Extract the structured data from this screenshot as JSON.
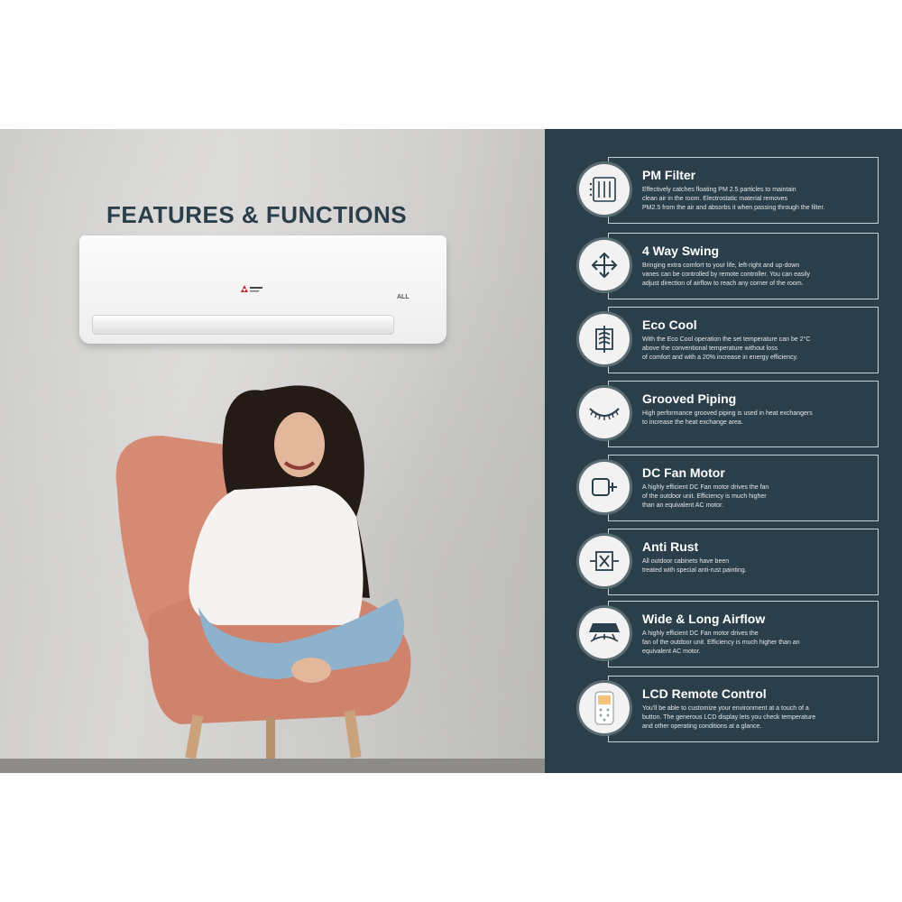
{
  "heading": "FEATURES & FUNCTIONS",
  "ac_badge": "ALL",
  "colors": {
    "panel": "#2b3f4a",
    "title": "#2b3f4a",
    "feature_title": "#ffffff"
  },
  "features": [
    {
      "title": "PM Filter",
      "icon": "pm-filter-icon",
      "lines": [
        "Effectively catches floating PM 2.5 particles to maintain",
        "clean air in the room. Electrostatic material removes",
        "PM2.5 from the air and absorbs it when passing through the filter."
      ]
    },
    {
      "title": "4 Way Swing",
      "icon": "four-way-arrows-icon",
      "lines": [
        "Bringing extra comfort to your life, left-right and up-down",
        "vanes can be controlled by remote controller. You can easily",
        "adjust direction of airflow to reach any corner of the room."
      ]
    },
    {
      "title": "Eco Cool",
      "icon": "eco-cool-icon",
      "lines": [
        "With the Eco Cool operation the set temperature can be 2°C",
        "above the conventional temperature without loss",
        "of comfort and with a 20% increase in energy efficiency."
      ]
    },
    {
      "title": "Grooved Piping",
      "icon": "grooved-piping-icon",
      "lines": [
        "High performance grooved piping is  used in heat exchangers",
        "to increase the heat exchange area."
      ]
    },
    {
      "title": "DC Fan Motor",
      "icon": "fan-motor-icon",
      "lines": [
        "A highly efficient DC Fan motor drives the  fan",
        "of the outdoor unit. Efficiency is much higher",
        "than an equivalent AC motor."
      ]
    },
    {
      "title": "Anti Rust",
      "icon": "anti-rust-icon",
      "lines": [
        "All outdoor cabinets have been",
        "treated with special anti-rust painting."
      ]
    },
    {
      "title": "Wide & Long Airflow",
      "icon": "airflow-icon",
      "lines": [
        "A highly efficient DC Fan motor drives the",
        "fan of the outdoor unit. Efficiency is much higher than an",
        "equivalent AC motor."
      ]
    },
    {
      "title": "LCD Remote Control",
      "icon": "remote-control-icon",
      "lines": [
        "You'll be able to customize your environment at a touch of a",
        "button. The generous LCD display lets you check temperature",
        "and other operating conditions at a glance."
      ]
    }
  ]
}
